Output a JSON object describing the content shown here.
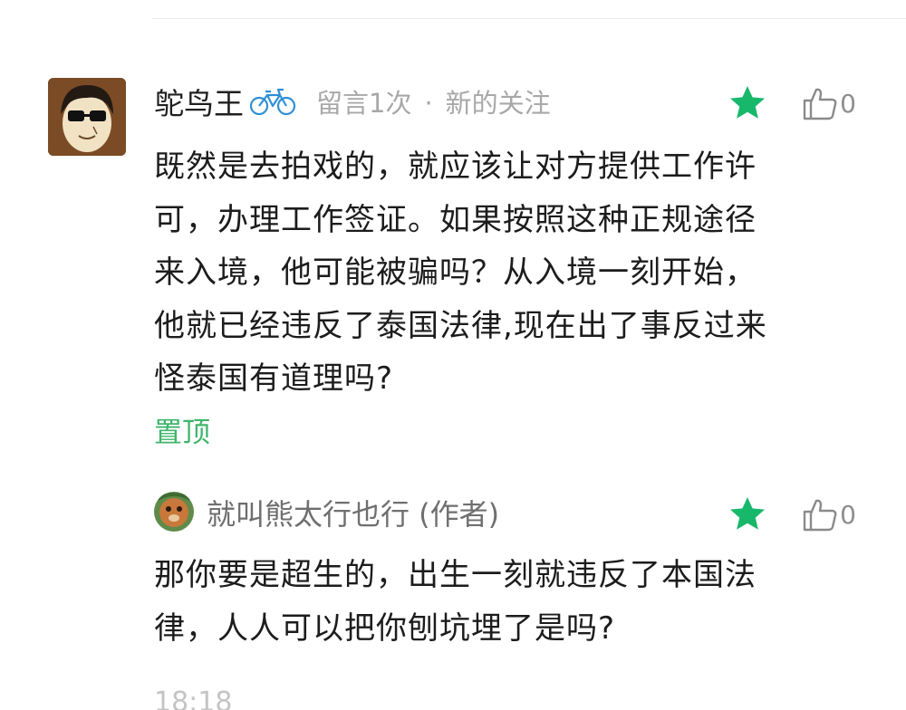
{
  "comment": {
    "author": "鸵鸟王",
    "meta_count": "留言1次",
    "meta_separator": "·",
    "meta_tag": "新的关注",
    "like_count": "0",
    "text": "既然是去拍戏的，就应该让对方提供工作许\n可，办理工作签证。如果按照这种正规途径\n来入境，他可能被骗吗？从入境一刻开始，\n他就已经违反了泰国法律,现在出了事反过来\n怪泰国有道理吗?",
    "pinned_label": "置顶",
    "author_badge_icon": "bicycle-icon"
  },
  "reply": {
    "author": "就叫熊太行也行 (作者)",
    "like_count": "0",
    "text": "那你要是超生的，出生一刻就违反了本国法\n律，人人可以把你刨坑埋了是吗?"
  },
  "timestamp": "18:18",
  "colors": {
    "accent_green": "#17b86a",
    "pinned_green": "#3fb56b",
    "meta_gray": "#a8a8a8"
  }
}
